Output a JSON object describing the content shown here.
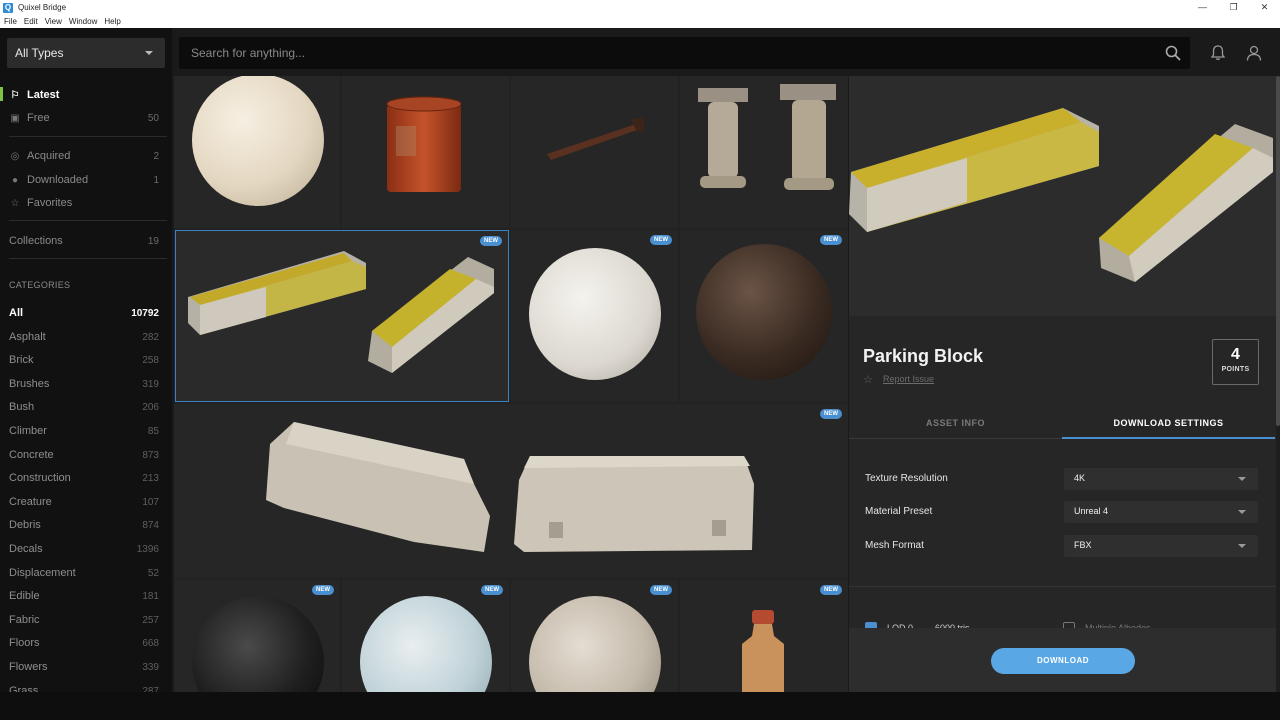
{
  "window": {
    "title": "Quixel Bridge",
    "controls": [
      "—",
      "❐",
      "✕"
    ]
  },
  "menu": [
    "File",
    "Edit",
    "View",
    "Window",
    "Help"
  ],
  "sidebar": {
    "type_select": "All Types",
    "nav": [
      {
        "label": "Latest",
        "count": "",
        "icon": "bookmark-icon",
        "glyph": "🔖"
      },
      {
        "label": "Free",
        "count": "50",
        "icon": "gift-icon",
        "glyph": "▣"
      },
      {
        "label": "Acquired",
        "count": "2",
        "icon": "check-circle-icon",
        "glyph": "⊘"
      },
      {
        "label": "Downloaded",
        "count": "1",
        "icon": "check-filled-icon",
        "glyph": "●"
      },
      {
        "label": "Favorites",
        "count": "",
        "icon": "star-icon",
        "glyph": "☆"
      },
      {
        "label": "Collections",
        "count": "19",
        "icon": "",
        "glyph": ""
      }
    ],
    "categories_heading": "CATEGORIES",
    "categories": [
      {
        "label": "All",
        "count": "10792"
      },
      {
        "label": "Asphalt",
        "count": "282"
      },
      {
        "label": "Brick",
        "count": "258"
      },
      {
        "label": "Brushes",
        "count": "319"
      },
      {
        "label": "Bush",
        "count": "206"
      },
      {
        "label": "Climber",
        "count": "85"
      },
      {
        "label": "Concrete",
        "count": "873"
      },
      {
        "label": "Construction",
        "count": "213"
      },
      {
        "label": "Creature",
        "count": "107"
      },
      {
        "label": "Debris",
        "count": "874"
      },
      {
        "label": "Decals",
        "count": "1396"
      },
      {
        "label": "Displacement",
        "count": "52"
      },
      {
        "label": "Edible",
        "count": "181"
      },
      {
        "label": "Fabric",
        "count": "257"
      },
      {
        "label": "Floors",
        "count": "668"
      },
      {
        "label": "Flowers",
        "count": "339"
      },
      {
        "label": "Grass",
        "count": "287"
      }
    ]
  },
  "search": {
    "placeholder": "Search for anything..."
  },
  "grid": {
    "badge": "NEW"
  },
  "detail": {
    "title": "Parking Block",
    "report": "Report Issue",
    "points": "4",
    "points_label": "POINTS",
    "tabs": [
      "ASSET INFO",
      "DOWNLOAD SETTINGS"
    ],
    "settings": [
      {
        "label": "Texture Resolution",
        "value": "4K"
      },
      {
        "label": "Material Preset",
        "value": "Unreal 4"
      },
      {
        "label": "Mesh Format",
        "value": "FBX"
      }
    ],
    "lod_label": "LOD 0",
    "lod_tris": "6000 tris",
    "multiple_albedos": "Multiple Albedos",
    "download": "DOWNLOAD"
  },
  "colors": {
    "accent": "#4a90d0",
    "active_bar": "#7fc344",
    "download": "#5aa7e6"
  }
}
